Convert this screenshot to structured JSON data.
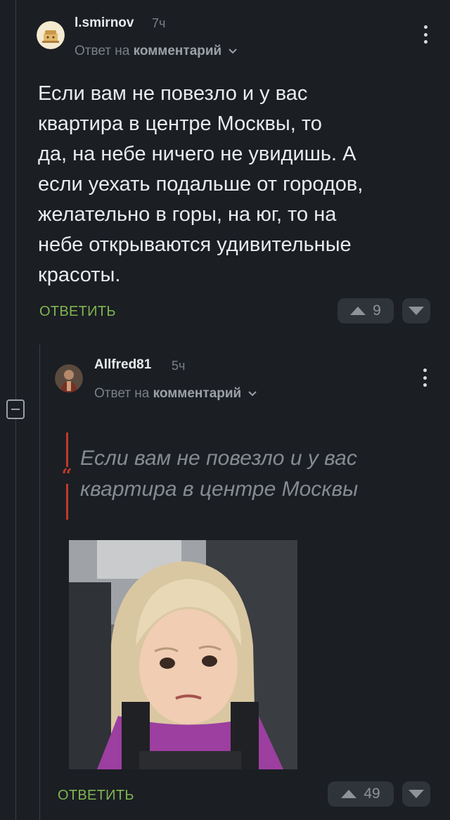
{
  "comment1": {
    "username": "l.smirnov",
    "time": "7ч",
    "reply_to_prefix": "Ответ на",
    "reply_to_link": "комментарий",
    "text": "Если вам не повезло и у вас\nквартира в центре Москвы, то\nда, на небе ничего не увидишь. А\nесли уехать подальше от городов,\nжелательно в горы, на юг, то на\nнебе открываются удивительные\nкрасоты.",
    "reply_label": "ОТВЕТИТЬ",
    "votes": "9"
  },
  "comment2": {
    "username": "Allfred81",
    "time": "5ч",
    "reply_to_prefix": "Ответ на",
    "reply_to_link": "комментарий",
    "quote": "Если вам не повезло и у вас\nквартира в центре Москвы",
    "reply_label": "ОТВЕТИТЬ",
    "votes": "49"
  },
  "colors": {
    "background": "#1b1e23",
    "accent_green": "#7fb552",
    "quote_red": "#c0392b"
  }
}
